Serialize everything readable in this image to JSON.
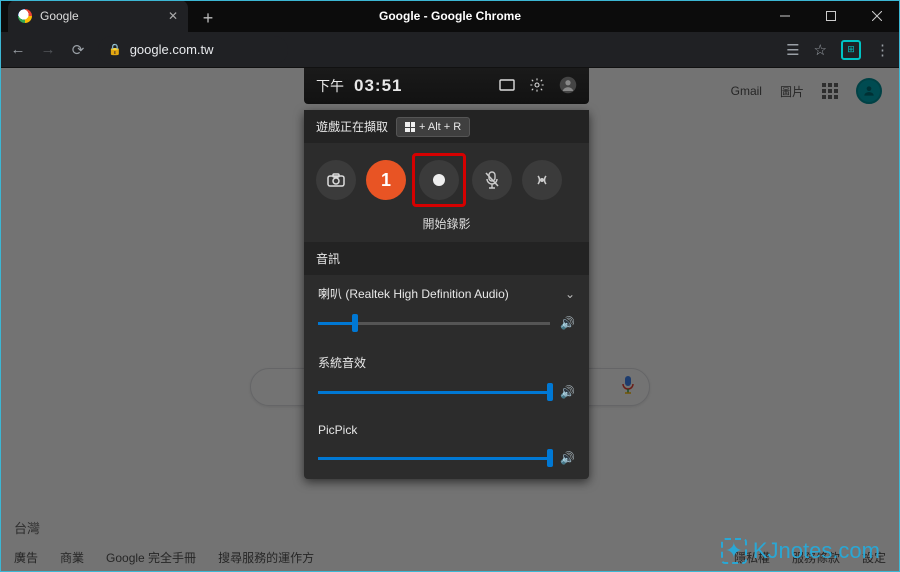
{
  "window": {
    "title": "Google - Google Chrome"
  },
  "browser": {
    "tab_title": "Google",
    "url": "google.com.tw",
    "links": {
      "gmail": "Gmail",
      "images": "圖片"
    }
  },
  "google_page": {
    "region": "台灣",
    "footer": {
      "ads": "廣告",
      "business": "商業",
      "about": "Google 完全手冊",
      "how_search": "搜尋服務的運作方",
      "privacy": "隱私權",
      "terms": "服務條款",
      "settings": "設定"
    }
  },
  "gamebar": {
    "time_prefix": "下午",
    "time": "03:51",
    "capture_title": "遊戲正在擷取",
    "tooltip": "+ Alt + R",
    "step_badge": "1",
    "start_record": "開始錄影",
    "audio_title": "音訊",
    "speaker_label": "喇叭 (Realtek High Definition Audio)",
    "system_sounds": "系統音效",
    "app_audio": "PicPick"
  },
  "watermark": {
    "text": "KJnotes.com"
  }
}
